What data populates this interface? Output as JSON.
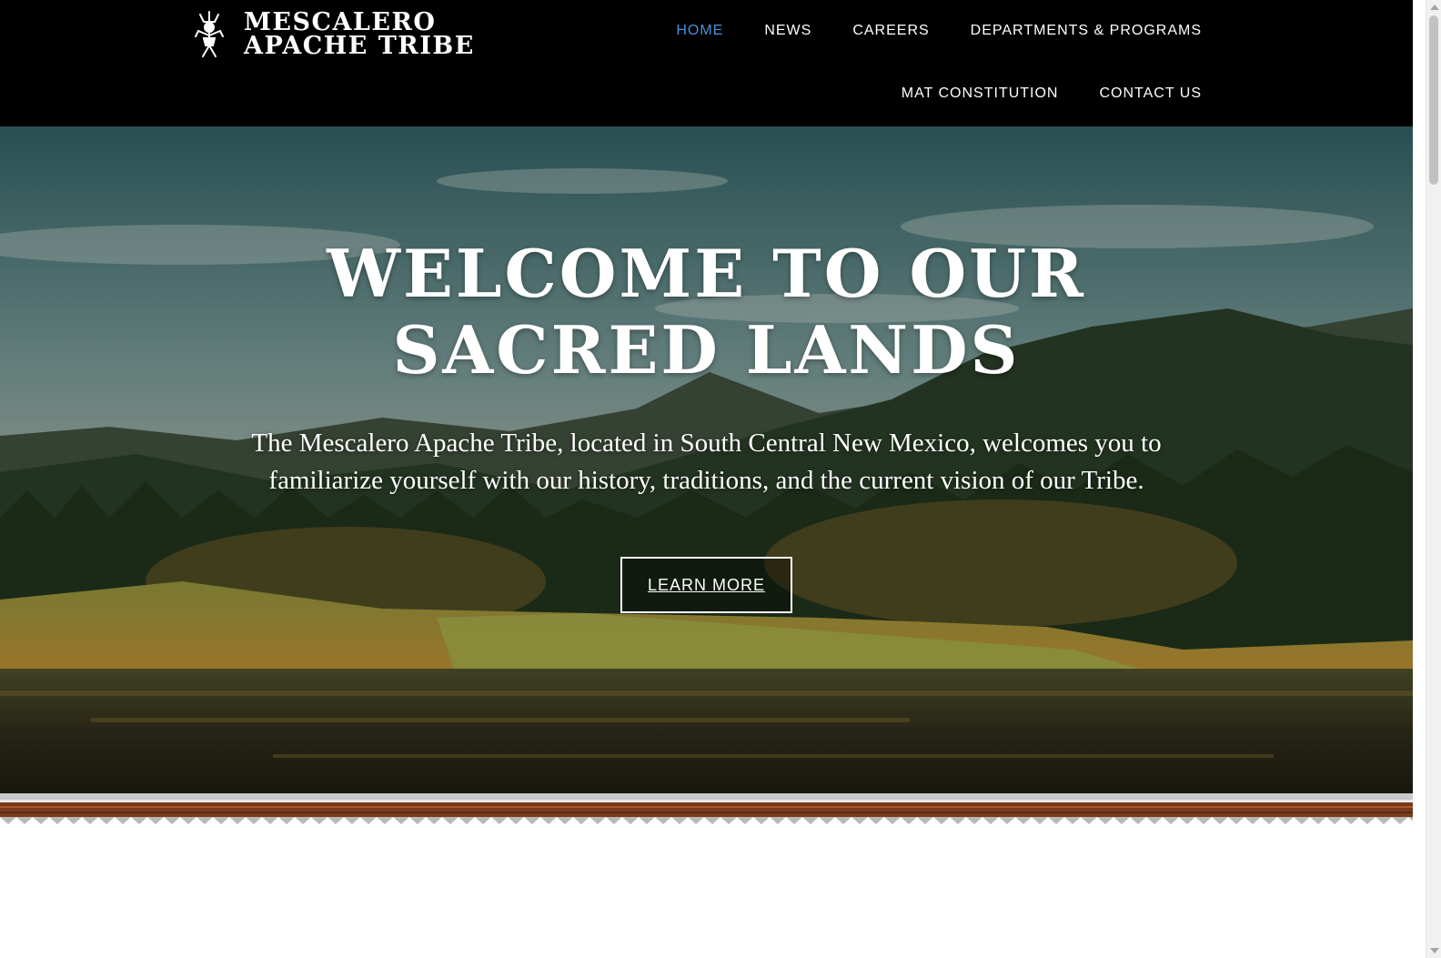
{
  "header": {
    "logo_line1": "MESCALERO",
    "logo_line2": "APACHE TRIBE",
    "logo_emblem": "apache-crown-dancer-emblem",
    "nav_row1": [
      {
        "label": "HOME",
        "active": true
      },
      {
        "label": "NEWS",
        "active": false
      },
      {
        "label": "CAREERS",
        "active": false
      },
      {
        "label": "DEPARTMENTS & PROGRAMS",
        "active": false
      }
    ],
    "nav_row2": [
      {
        "label": "MAT CONSTITUTION",
        "active": false
      },
      {
        "label": "CONTACT US",
        "active": false
      }
    ]
  },
  "hero": {
    "title_line1": "WELCOME TO OUR",
    "title_line2": "SACRED LANDS",
    "subtitle": "The Mescalero Apache Tribe, located in South Central New Mexico, welcomes you to familiarize yourself with our history, traditions, and the current vision of our Tribe.",
    "cta_label": "LEARN MORE",
    "background": "mountain-forest-lake-landscape"
  },
  "colors": {
    "header_bg": "#000000",
    "nav_active": "#4a90d9",
    "nav_text": "#ffffff",
    "border_brown": "#7a3b1c",
    "border_silver": "#c8c8c8"
  }
}
